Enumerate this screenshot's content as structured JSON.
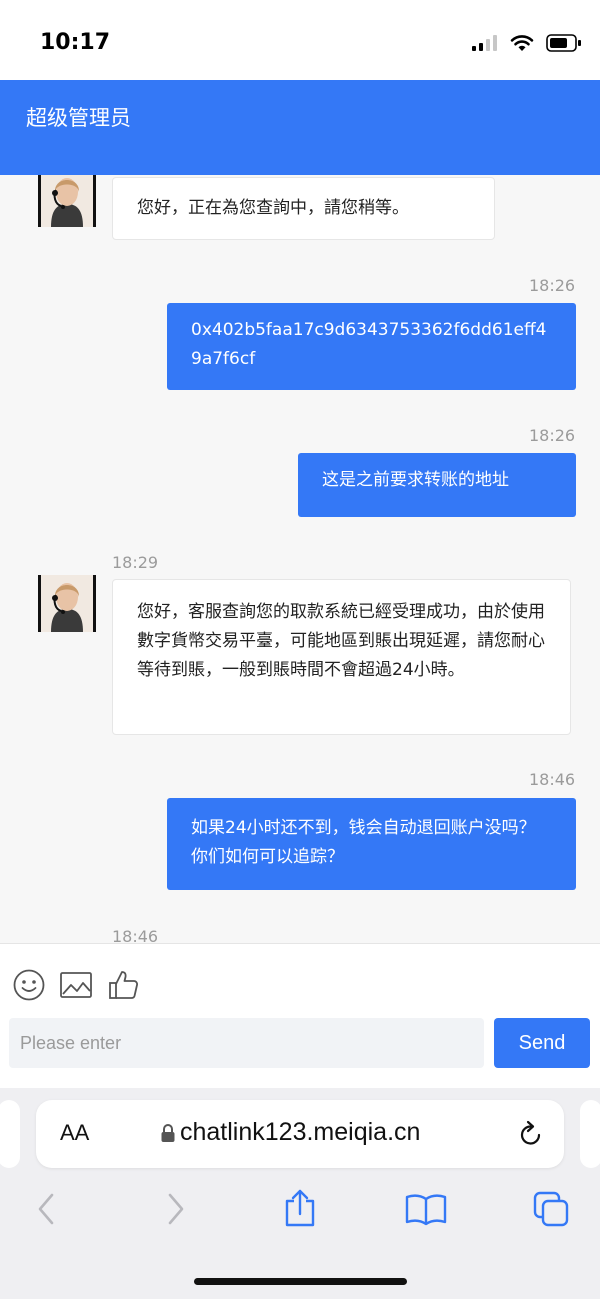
{
  "status_bar": {
    "time": "10:17"
  },
  "header": {
    "title": "超级管理员"
  },
  "messages": [
    {
      "side": "in",
      "text": "您好，正在為您查詢中，請您稍等。"
    },
    {
      "side": "out",
      "time": "18:26",
      "text": "0x402b5faa17c9d6343753362f6dd61eff49a7f6cf"
    },
    {
      "side": "out",
      "time": "18:26",
      "text": "这是之前要求转账的地址"
    },
    {
      "side": "in",
      "time": "18:29",
      "text": "您好，客服查詢您的取款系統已經受理成功，由於使用數字貨幣交易平臺，可能地區到賬出現延遲，請您耐心等待到賬，一般到賬時間不會超過24小時。"
    },
    {
      "side": "out",
      "time": "18:46",
      "text": "如果24小时还不到，钱会自动退回账户没吗？你们如何可以追踪？"
    },
    {
      "side": "in",
      "time": "18:46",
      "text": ""
    }
  ],
  "composer": {
    "icons": [
      "smiley-icon",
      "image-icon",
      "thumbs-up-icon"
    ],
    "placeholder": "Please enter",
    "value": "",
    "send_label": "Send"
  },
  "browser": {
    "text_size_label": "AA",
    "url": "chatlink123.meiqia.cn",
    "nav_icons": [
      "back-icon",
      "forward-icon",
      "share-icon",
      "bookmarks-icon",
      "tabs-icon"
    ]
  },
  "colors": {
    "accent": "#3478f6",
    "background": "#f7f7f7",
    "timestamp": "#9b9b9b"
  }
}
